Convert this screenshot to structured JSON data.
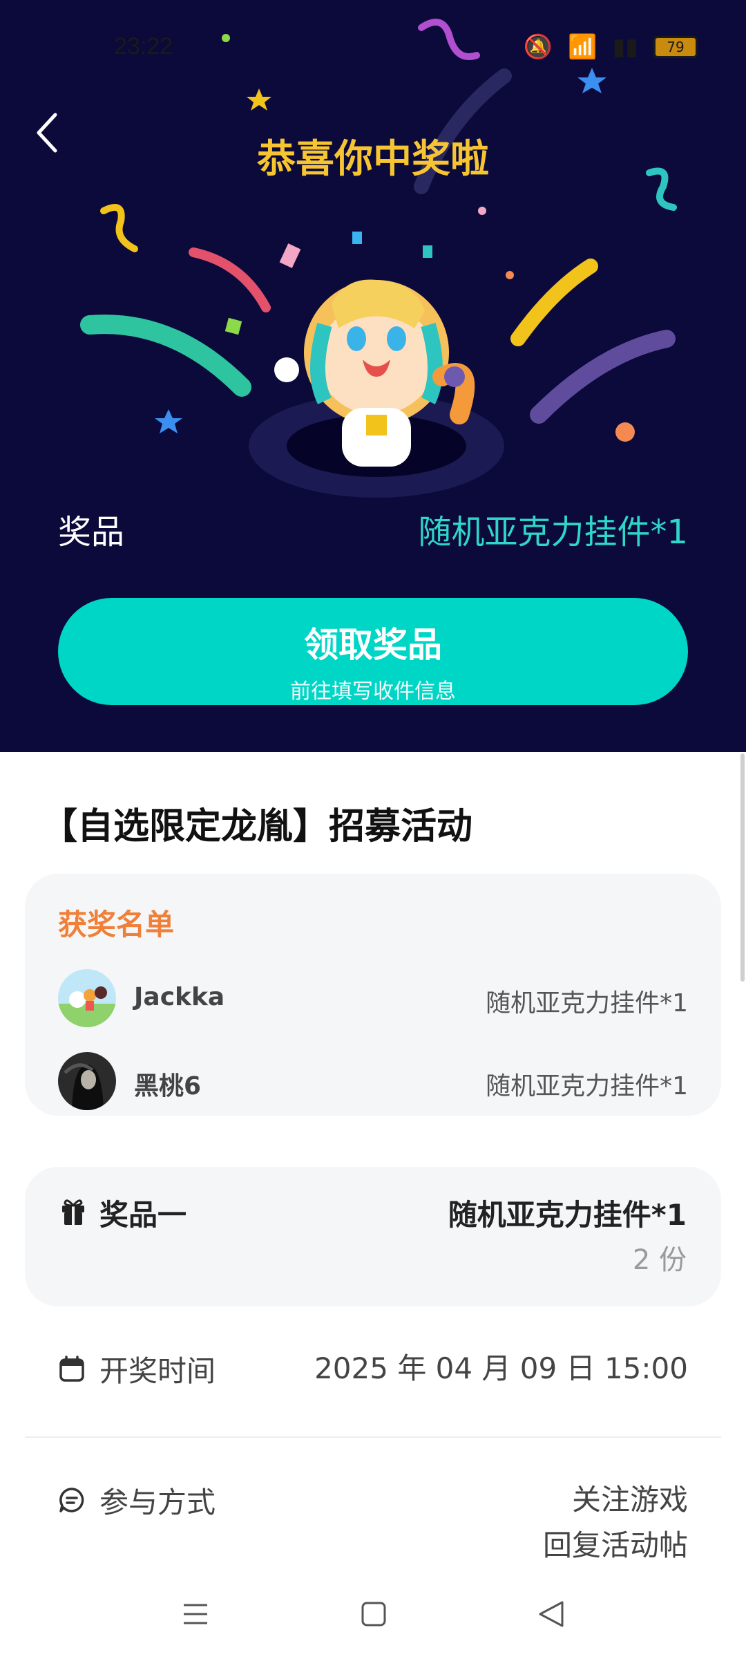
{
  "status_bar": {
    "time": "23:22",
    "battery": "79"
  },
  "hero": {
    "title": "恭喜你中奖啦",
    "prize_label": "奖品",
    "prize_value": "随机亚克力挂件*1",
    "claim_button": {
      "label": "领取奖品",
      "sublabel": "前往填写收件信息"
    }
  },
  "event": {
    "title": "【自选限定龙胤】招募活动"
  },
  "winners": {
    "title": "获奖名单",
    "items": [
      {
        "name": "Jackka",
        "prize": "随机亚克力挂件*1"
      },
      {
        "name": "黑桃6",
        "prize": "随机亚克力挂件*1"
      }
    ]
  },
  "award": {
    "label": "奖品一",
    "prize": "随机亚克力挂件*1",
    "count": "2 份"
  },
  "draw_time": {
    "label": "开奖时间",
    "value": "2025 年 04 月 09 日 15:00"
  },
  "participation": {
    "label": "参与方式",
    "line1": "关注游戏",
    "line2": "回复活动帖"
  },
  "colors": {
    "hero_bg": "#0b0a3a",
    "accent": "#00d6c6",
    "title_gold": "#f7c531",
    "winners_orange": "#f08039"
  }
}
